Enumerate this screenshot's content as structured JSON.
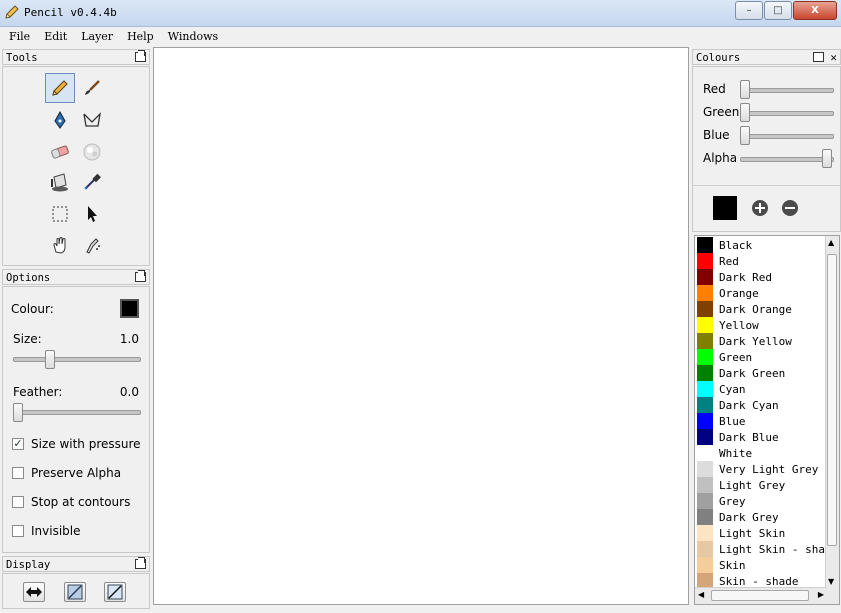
{
  "window": {
    "title": "Pencil v0.4.4b",
    "minimize": "–",
    "maximize": "□",
    "close": "X"
  },
  "menu": [
    "File",
    "Edit",
    "Layer",
    "Help",
    "Windows"
  ],
  "tools_panel": {
    "title": "Tools"
  },
  "options_panel": {
    "title": "Options",
    "colour_label": "Colour:",
    "size_label": "Size:",
    "size_value": "1.0",
    "size_fraction": 0.28,
    "feather_label": "Feather:",
    "feather_value": "0.0",
    "feather_fraction": 0.0,
    "checkboxes": [
      {
        "label": "Size with pressure",
        "checked": true
      },
      {
        "label": "Preserve Alpha",
        "checked": false
      },
      {
        "label": "Stop at contours",
        "checked": false
      },
      {
        "label": "Invisible",
        "checked": false
      }
    ]
  },
  "display_panel": {
    "title": "Display"
  },
  "colours_panel": {
    "title": "Colours",
    "sliders": [
      {
        "label": "Red",
        "value": 0.0
      },
      {
        "label": "Green",
        "value": 0.0
      },
      {
        "label": "Blue",
        "value": 0.0
      },
      {
        "label": "Alpha",
        "value": 1.0
      }
    ],
    "current_colour": "#000000",
    "palette": [
      {
        "name": "Black",
        "color": "#000000"
      },
      {
        "name": "Red",
        "color": "#ff0000"
      },
      {
        "name": "Dark Red",
        "color": "#800000"
      },
      {
        "name": "Orange",
        "color": "#ff8000"
      },
      {
        "name": "Dark Orange",
        "color": "#804000"
      },
      {
        "name": "Yellow",
        "color": "#ffff00"
      },
      {
        "name": "Dark Yellow",
        "color": "#808000"
      },
      {
        "name": "Green",
        "color": "#00ff00"
      },
      {
        "name": "Dark Green",
        "color": "#008000"
      },
      {
        "name": "Cyan",
        "color": "#00ffff"
      },
      {
        "name": "Dark Cyan",
        "color": "#008080"
      },
      {
        "name": "Blue",
        "color": "#0000ff"
      },
      {
        "name": "Dark Blue",
        "color": "#000080"
      },
      {
        "name": "White",
        "color": "#ffffff"
      },
      {
        "name": "Very Light Grey",
        "color": "#dcdcdc"
      },
      {
        "name": "Light Grey",
        "color": "#c0c0c0"
      },
      {
        "name": "Grey",
        "color": "#a0a0a0"
      },
      {
        "name": "Dark Grey",
        "color": "#808080"
      },
      {
        "name": "Light Skin",
        "color": "#ffe4c4"
      },
      {
        "name": "Light Skin - shade",
        "color": "#e6c8a4"
      },
      {
        "name": "Skin",
        "color": "#f5cd9b"
      },
      {
        "name": "Skin - shade",
        "color": "#d2a678"
      }
    ]
  }
}
